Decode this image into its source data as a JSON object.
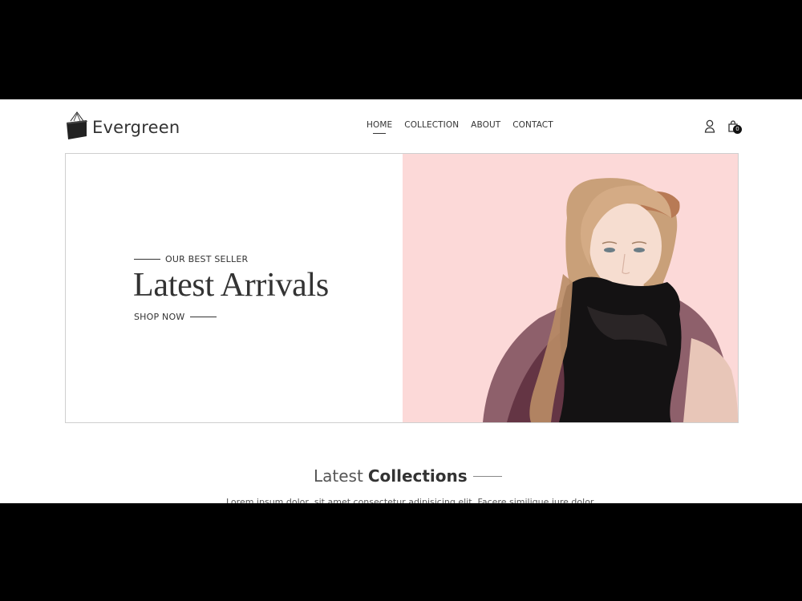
{
  "brand": {
    "name": "Evergreen",
    "logo_icon": "shopping-bag-icon"
  },
  "nav": {
    "items": [
      {
        "label": "HOME",
        "active": true
      },
      {
        "label": "COLLECTION",
        "active": false
      },
      {
        "label": "ABOUT",
        "active": false
      },
      {
        "label": "CONTACT",
        "active": false
      }
    ]
  },
  "header_icons": {
    "account_icon": "user-icon",
    "cart_icon": "cart-bag-icon",
    "cart_count": "0"
  },
  "hero": {
    "eyebrow": "OUR BEST SELLER",
    "title": "Latest Arrivals",
    "cta": "SHOP NOW",
    "image_bg_color": "#fcd9d8"
  },
  "collections": {
    "title_light": "Latest",
    "title_bold": "Collections",
    "description": "Lorem ipsum dolor, sit amet consectetur adipisicing elit. Facere similique iure dolor"
  },
  "colors": {
    "text": "#333333",
    "hero_pink": "#fcd9d8",
    "border": "#cfcfcf"
  }
}
